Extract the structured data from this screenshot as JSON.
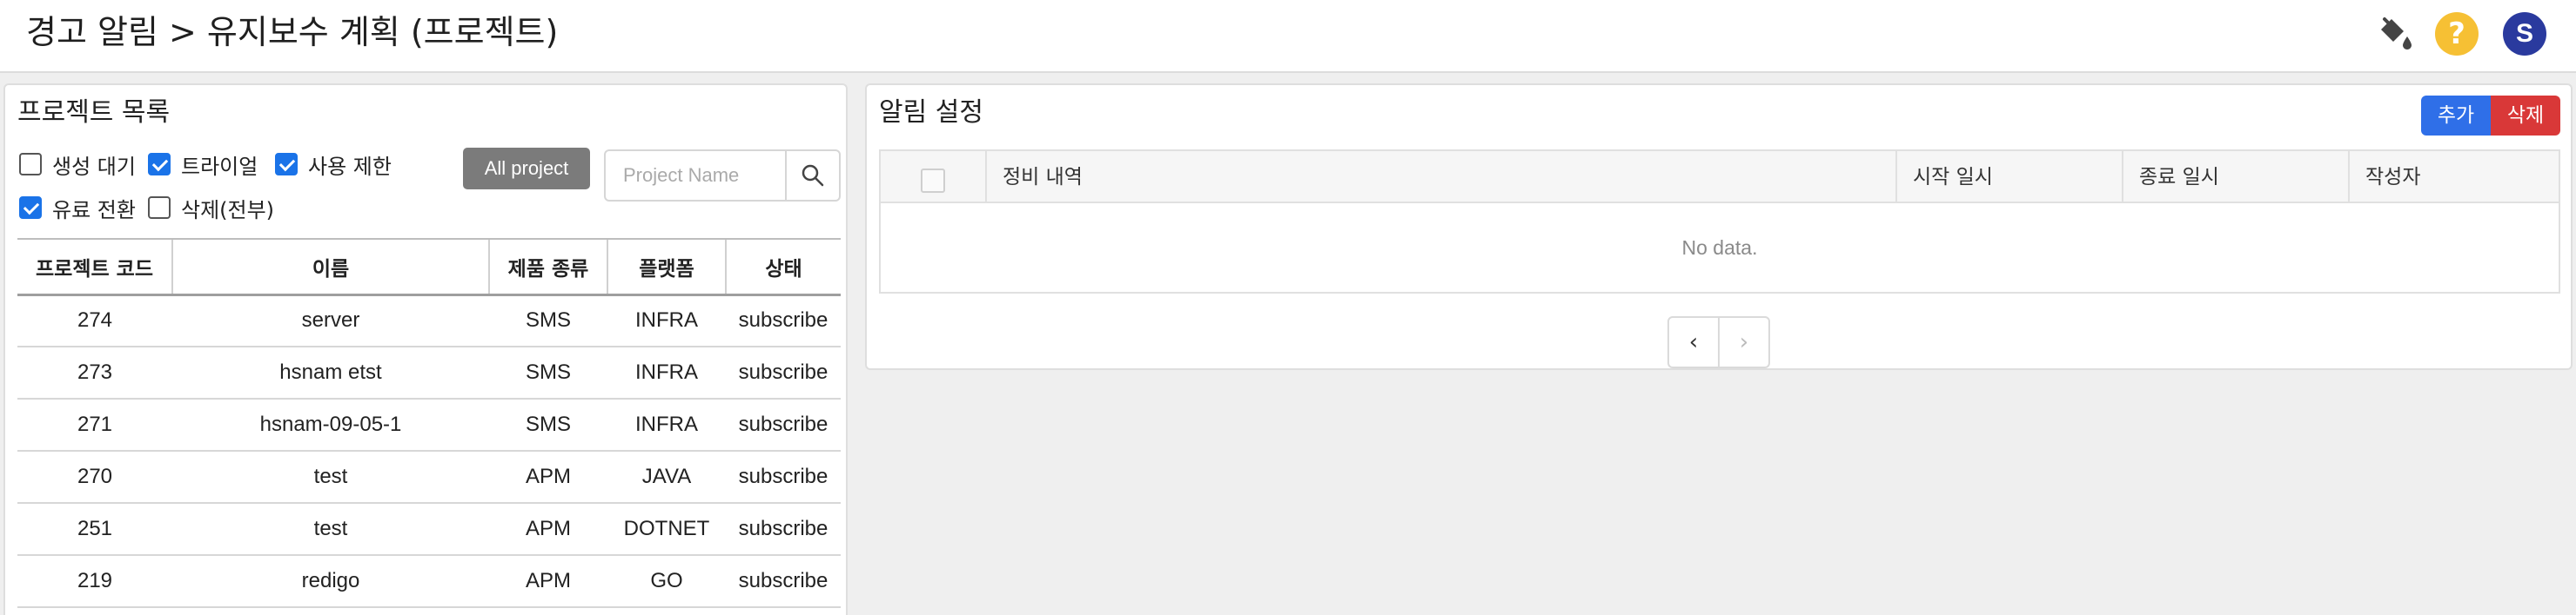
{
  "header": {
    "breadcrumb": "경고 알림 > 유지보수 계획 (프로젝트)",
    "icons": [
      "paint-bucket-icon",
      "help-icon"
    ],
    "avatar_letter": "S",
    "colors": {
      "help": "#f6c034",
      "avatar": "#2a3a9e"
    }
  },
  "project_panel": {
    "title": "프로젝트 목록",
    "filters": [
      {
        "label": "생성 대기",
        "checked": false
      },
      {
        "label": "트라이얼",
        "checked": true
      },
      {
        "label": "사용 제한",
        "checked": true
      },
      {
        "label": "유료 전환",
        "checked": true
      },
      {
        "label": "삭제(전부)",
        "checked": false
      }
    ],
    "all_project_button": "All project",
    "search": {
      "placeholder": "Project Name",
      "value": ""
    },
    "table": {
      "headers": [
        "프로젝트 코드",
        "이름",
        "제품 종류",
        "플랫폼",
        "상태"
      ],
      "rows": [
        [
          "274",
          "server",
          "SMS",
          "INFRA",
          "subscribe"
        ],
        [
          "273",
          "hsnam etst",
          "SMS",
          "INFRA",
          "subscribe"
        ],
        [
          "271",
          "hsnam-09-05-1",
          "SMS",
          "INFRA",
          "subscribe"
        ],
        [
          "270",
          "test",
          "APM",
          "JAVA",
          "subscribe"
        ],
        [
          "251",
          "test",
          "APM",
          "DOTNET",
          "subscribe"
        ],
        [
          "219",
          "redigo",
          "APM",
          "GO",
          "subscribe"
        ]
      ]
    }
  },
  "alert_panel": {
    "title": "알림 설정",
    "add_button": "추가",
    "delete_button": "삭제",
    "colors": {
      "add": "#2f6fe8",
      "delete": "#d93838"
    },
    "table": {
      "headers": [
        "정비 내역",
        "시작 일시",
        "종료 일시",
        "작성자"
      ],
      "empty_text": "No data."
    },
    "pagination": {
      "prev": "‹",
      "next": "›"
    }
  }
}
